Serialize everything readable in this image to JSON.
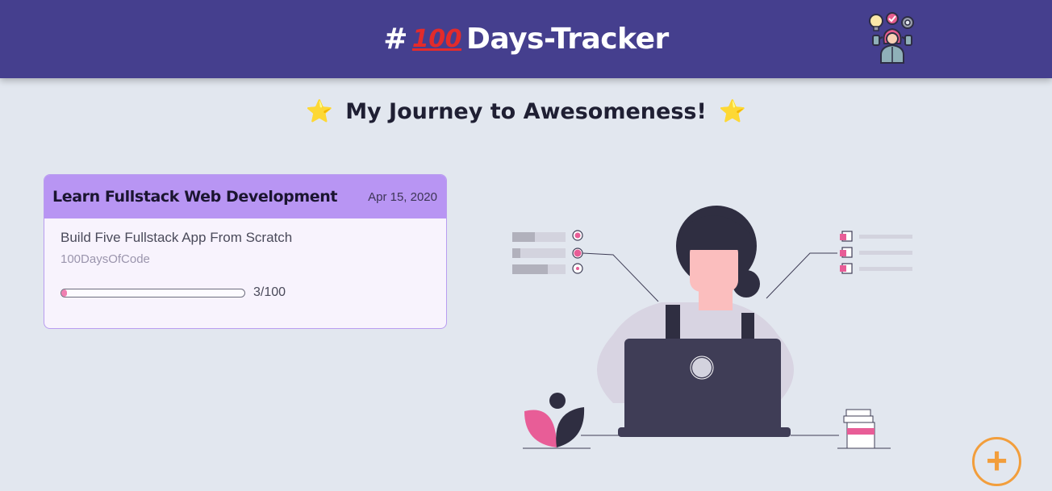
{
  "header": {
    "hash": "#",
    "hundred_icon": "100",
    "title": "Days-Tracker"
  },
  "subtitle": {
    "star": "⭐",
    "text": "My Journey to Awesomeness!"
  },
  "tracker_card": {
    "title": "Learn Fullstack Web Development",
    "date": "Apr 15, 2020",
    "goal": "Build Five Fullstack App From Scratch",
    "tag": "100DaysOfCode",
    "progress_fraction": 0.03,
    "progress_label": "3/100"
  },
  "add_button": {
    "icon": "plus-icon",
    "symbol": "+"
  },
  "colors": {
    "header_bg": "#453f8e",
    "page_bg": "#e2e7ef",
    "card_header": "#b895f3",
    "accent_pink": "#f07fb1",
    "fab_orange": "#f29e3c"
  }
}
